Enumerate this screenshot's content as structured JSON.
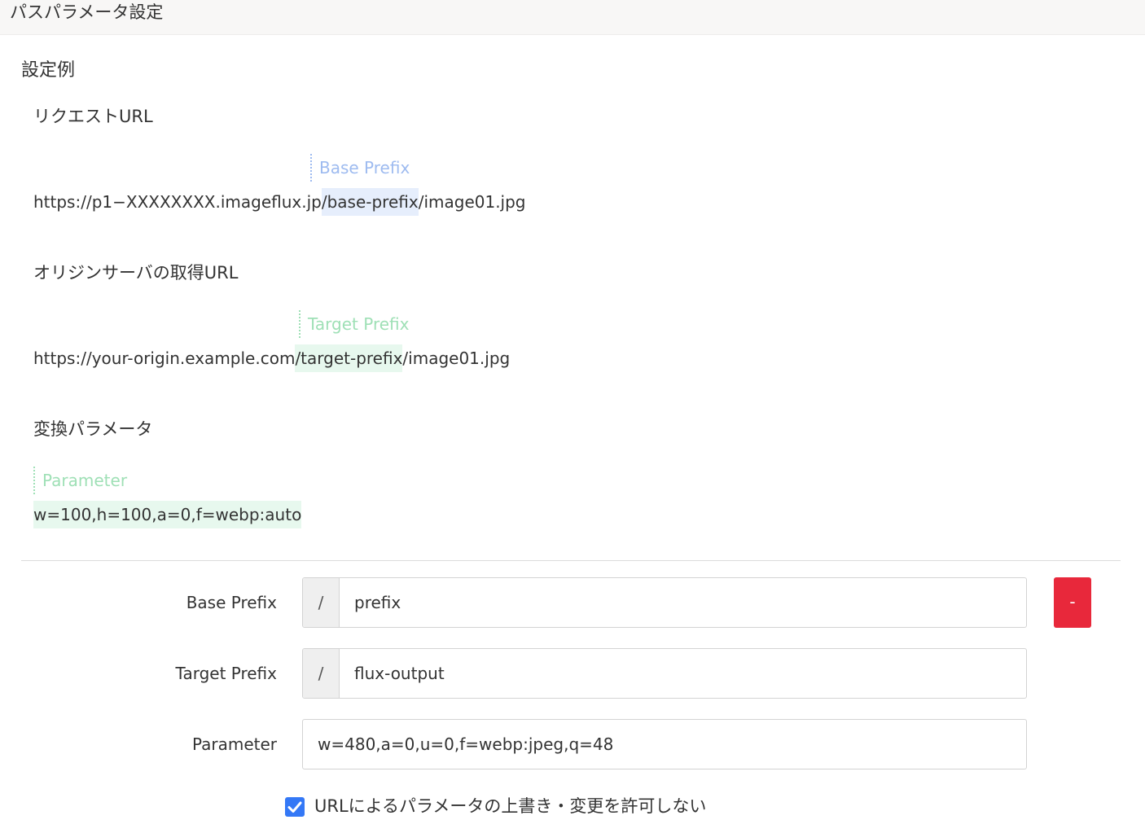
{
  "header": {
    "title": "パスパラメータ設定"
  },
  "example": {
    "title": "設定例",
    "request": {
      "label": "リクエストURL",
      "marker": "Base Prefix",
      "url_before": "https://p1−XXXXXXXX.imageflux.jp",
      "url_highlight": "/base-prefix",
      "url_after": "/image01.jpg"
    },
    "origin": {
      "label": "オリジンサーバの取得URL",
      "marker": "Target Prefix",
      "url_before": "https://your-origin.example.com",
      "url_highlight": "/target-prefix",
      "url_after": "/image01.jpg"
    },
    "params": {
      "label": "変換パラメータ",
      "marker": "Parameter",
      "value": "w=100,h=100,a=0,f=webp:auto"
    }
  },
  "form": {
    "base_prefix": {
      "label": "Base Prefix",
      "addon": "/",
      "value": "prefix"
    },
    "target_prefix": {
      "label": "Target Prefix",
      "addon": "/",
      "value": "flux-output"
    },
    "parameter": {
      "label": "Parameter",
      "value": "w=480,a=0,u=0,f=webp:jpeg,q=48"
    },
    "remove_label": "-",
    "checkbox": {
      "label": "URLによるパラメータの上書き・変更を許可しない",
      "checked": true
    }
  },
  "colors": {
    "remove_button": "#e8283b",
    "checkbox": "#3478f6",
    "base_marker": "#9ebbf0",
    "green_marker": "#9fe0b6"
  }
}
